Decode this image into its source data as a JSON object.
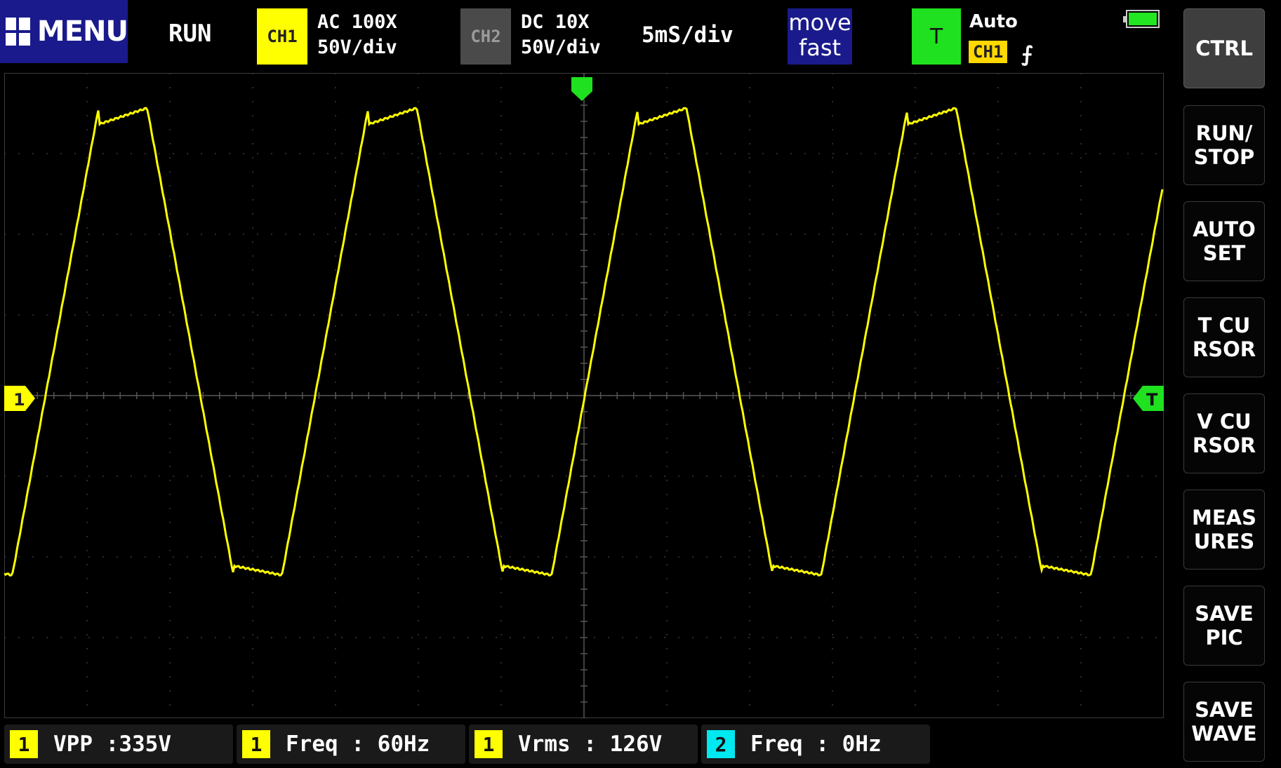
{
  "topbar": {
    "menu_label": "MENU",
    "run_status": "RUN",
    "ch1": {
      "label": "CH1",
      "coupling": "AC 100X",
      "scale": "50V/div",
      "color": "#ffff00"
    },
    "ch2": {
      "label": "CH2",
      "coupling": "DC 10X",
      "scale": "50V/div",
      "color": "#4a4a4a"
    },
    "timebase": "5mS/div",
    "move": {
      "line1": "move",
      "line2": "fast"
    },
    "trigger": {
      "label": "T",
      "mode": "Auto",
      "source": "CH1",
      "edge": "⨍",
      "color": "#1fe11f"
    },
    "battery_icon": "battery-full-icon"
  },
  "side_buttons": [
    {
      "label": "CTRL"
    },
    {
      "label": "RUN/\nSTOP"
    },
    {
      "label": "AUTO\nSET"
    },
    {
      "label": "T CU\nRSOR"
    },
    {
      "label": "V CU\nRSOR"
    },
    {
      "label": "MEAS\nURES"
    },
    {
      "label": "SAVE\nPIC"
    },
    {
      "label": "SAVE\nWAVE"
    }
  ],
  "scope": {
    "ch1_marker": "1",
    "trigger_marker": "T",
    "grid_divisions": {
      "x": 14,
      "y": 8
    },
    "trace_color": "#ffff00",
    "waveform": {
      "cycles_visible": 4.3,
      "frequency_hz": 60
    }
  },
  "measurements": [
    {
      "channel": "1",
      "name": "VPP",
      "sep": ":",
      "value": "335V",
      "color": "#ffff00"
    },
    {
      "channel": "1",
      "name": "Freq",
      "sep": ":",
      "value": "60Hz",
      "color": "#ffff00"
    },
    {
      "channel": "1",
      "name": "Vrms",
      "sep": ":",
      "value": "126V",
      "color": "#ffff00"
    },
    {
      "channel": "2",
      "name": "Freq",
      "sep": ":",
      "value": "0Hz",
      "color": "#00e8f0"
    }
  ]
}
